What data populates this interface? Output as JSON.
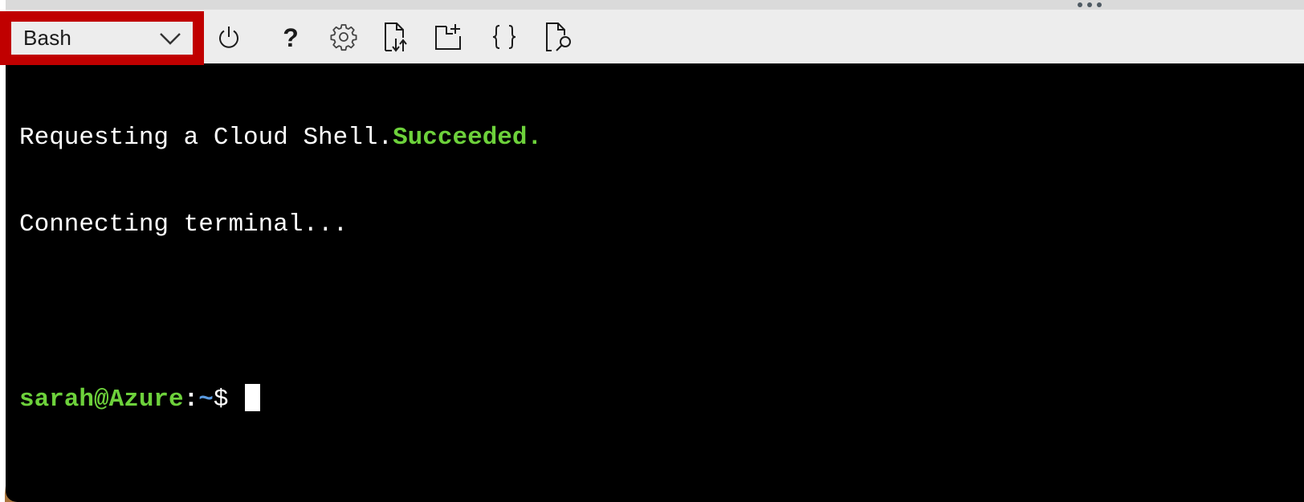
{
  "toolbar": {
    "shell_selector": {
      "selected": "Bash",
      "highlighted": true,
      "highlight_color": "#c00000"
    },
    "buttons": [
      {
        "name": "restart",
        "icon": "power-icon",
        "tooltip": "Restart Cloud Shell"
      },
      {
        "name": "help",
        "icon": "question-icon",
        "tooltip": "Help"
      },
      {
        "name": "settings",
        "icon": "gear-icon",
        "tooltip": "Settings"
      },
      {
        "name": "upload-download",
        "icon": "file-transfer-icon",
        "tooltip": "Upload/Download files"
      },
      {
        "name": "new-session",
        "icon": "new-session-icon",
        "tooltip": "Open new session"
      },
      {
        "name": "editor",
        "icon": "braces-icon",
        "tooltip": "Open editor"
      },
      {
        "name": "web-preview",
        "icon": "web-preview-icon",
        "tooltip": "Web preview"
      }
    ]
  },
  "terminal": {
    "lines": [
      {
        "text": "Requesting a Cloud Shell.",
        "status": "Succeeded."
      },
      {
        "text": "Connecting terminal..."
      },
      {
        "text": ""
      }
    ],
    "prompt": {
      "user_host": "sarah@Azure",
      "colon": ":",
      "path": "~",
      "sign": "$ "
    },
    "colors": {
      "background": "#000000",
      "foreground": "#ffffff",
      "success": "#6dd13b",
      "path": "#5a9ae0"
    }
  }
}
